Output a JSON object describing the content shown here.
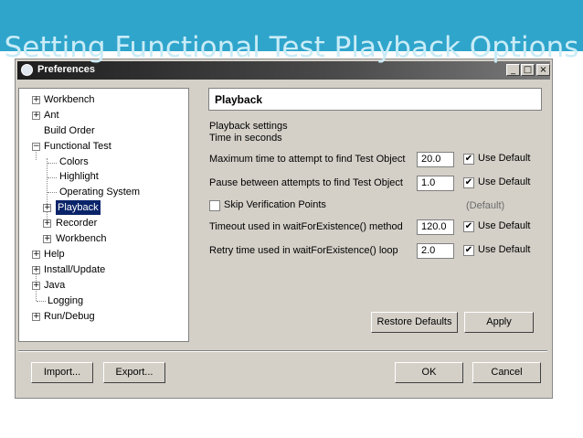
{
  "slide": {
    "title": "Setting Functional Test Playback Options"
  },
  "window": {
    "title": "Preferences",
    "min_glyph": "_",
    "max_glyph": "□",
    "close_glyph": "×"
  },
  "tree": {
    "workbench": "Workbench",
    "ant": "Ant",
    "build_order": "Build Order",
    "functional_test": "Functional Test",
    "colors": "Colors",
    "highlight": "Highlight",
    "operating_system": "Operating System",
    "playback": "Playback",
    "recorder": "Recorder",
    "ft_workbench": "Workbench",
    "help": "Help",
    "install_update": "Install/Update",
    "java": "Java",
    "logging": "Logging",
    "run_debug": "Run/Debug",
    "plus": "+",
    "minus": "−"
  },
  "panel": {
    "header": "Playback",
    "section1": "Playback settings",
    "section2": "Time in seconds",
    "max_time_label": "Maximum time to attempt to find Test Object",
    "max_time_value": "20.0",
    "pause_label": "Pause between attempts to find Test Object",
    "pause_value": "1.0",
    "skip_label": "Skip Verification Points",
    "skip_default": "(Default)",
    "timeout_label": "Timeout used in waitForExistence() method",
    "timeout_value": "120.0",
    "retry_label": "Retry time used in waitForExistence() loop",
    "retry_value": "2.0",
    "use_default": "Use Default",
    "checkmark": "✔"
  },
  "buttons": {
    "restore_defaults": "Restore Defaults",
    "apply": "Apply",
    "import": "Import...",
    "export": "Export...",
    "ok": "OK",
    "cancel": "Cancel"
  }
}
